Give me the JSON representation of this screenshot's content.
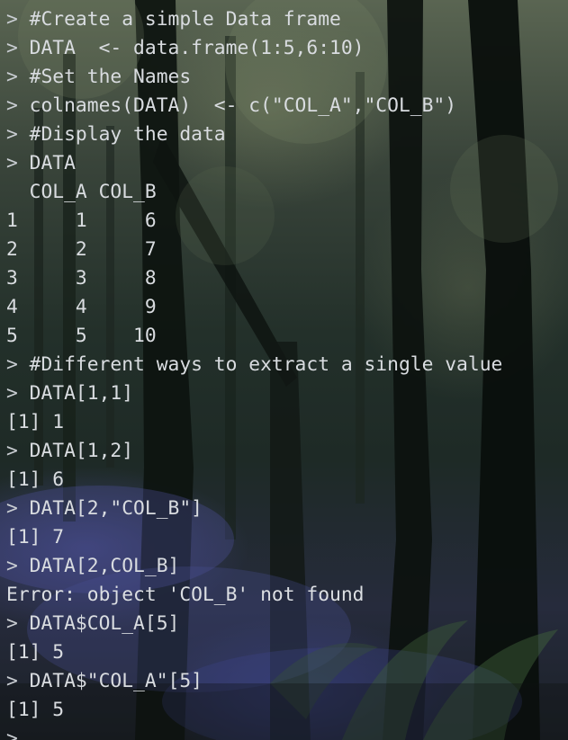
{
  "prompt_char": ">",
  "lines": [
    {
      "kind": "input",
      "text": " #Create a simple Data frame"
    },
    {
      "kind": "input",
      "text": " DATA  <- data.frame(1:5,6:10)"
    },
    {
      "kind": "input",
      "text": " #Set the Names"
    },
    {
      "kind": "input",
      "text": " colnames(DATA)  <- c(\"COL_A\",\"COL_B\")"
    },
    {
      "kind": "input",
      "text": " #Display the data"
    },
    {
      "kind": "input",
      "text": " DATA"
    },
    {
      "kind": "output",
      "text": "  COL_A COL_B"
    },
    {
      "kind": "output",
      "text": "1     1     6"
    },
    {
      "kind": "output",
      "text": "2     2     7"
    },
    {
      "kind": "output",
      "text": "3     3     8"
    },
    {
      "kind": "output",
      "text": "4     4     9"
    },
    {
      "kind": "output",
      "text": "5     5    10"
    },
    {
      "kind": "input",
      "text": " #Different ways to extract a single value"
    },
    {
      "kind": "input",
      "text": " DATA[1,1]"
    },
    {
      "kind": "output",
      "text": "[1] 1"
    },
    {
      "kind": "input",
      "text": " DATA[1,2]"
    },
    {
      "kind": "output",
      "text": "[1] 6"
    },
    {
      "kind": "input",
      "text": " DATA[2,\"COL_B\"]"
    },
    {
      "kind": "output",
      "text": "[1] 7"
    },
    {
      "kind": "input",
      "text": " DATA[2,COL_B]"
    },
    {
      "kind": "error",
      "text": "Error: object 'COL_B' not found"
    },
    {
      "kind": "input",
      "text": " DATA$COL_A[5]"
    },
    {
      "kind": "output",
      "text": "[1] 5"
    },
    {
      "kind": "input",
      "text": " DATA$\"COL_A\"[5]"
    },
    {
      "kind": "output",
      "text": "[1] 5"
    },
    {
      "kind": "input",
      "text": ""
    }
  ]
}
